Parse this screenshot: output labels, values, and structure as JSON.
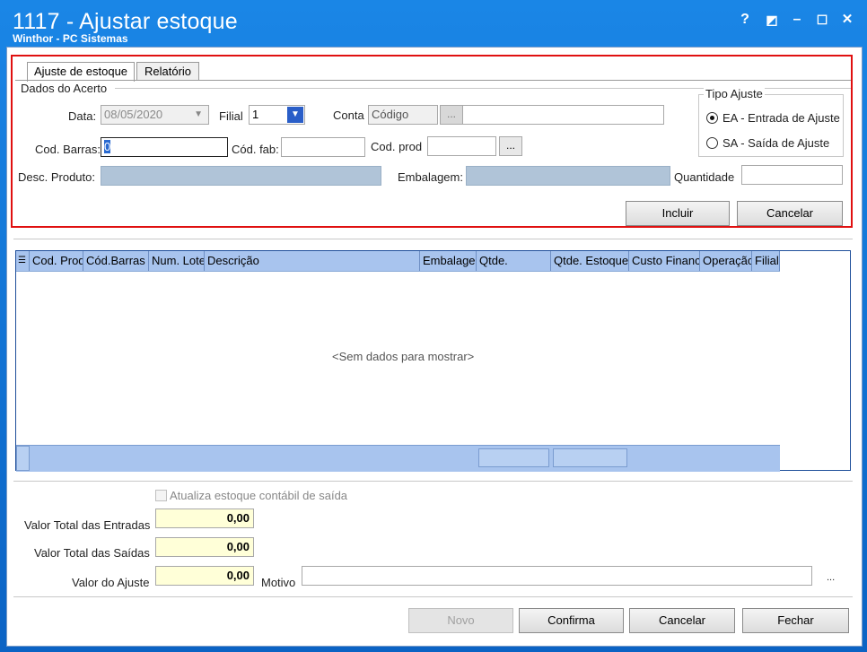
{
  "window": {
    "title": "1117 - Ajustar estoque",
    "subtitle": "Winthor - PC Sistemas",
    "controls": {
      "help": "?",
      "theme": "◩",
      "minimize": "–",
      "maximize": "☐",
      "close": "✕"
    }
  },
  "tabs": [
    {
      "label": "Ajuste de estoque",
      "active": true
    },
    {
      "label": "Relatório",
      "active": false
    }
  ],
  "dados_acerto": {
    "group_label": "Dados do Acerto",
    "data_label": "Data:",
    "data_value": "08/05/2020",
    "filial_label": "Filial",
    "filial_value": "1",
    "conta_label": "Conta",
    "conta_placeholder": "Código",
    "conta_button": "...",
    "cod_barras_label": "Cod. Barras:",
    "cod_barras_value": "0",
    "cod_fab_label": "Cód. fab:",
    "cod_prod_label": "Cod. prod",
    "cod_prod_button": "...",
    "desc_produto_label": "Desc. Produto:",
    "embalagem_label": "Embalagem:",
    "quantidade_label": "Quantidade"
  },
  "tipo_ajuste": {
    "label": "Tipo Ajuste",
    "options": [
      {
        "label": "EA - Entrada de Ajuste",
        "selected": true
      },
      {
        "label": "SA - Saída de Ajuste",
        "selected": false
      }
    ]
  },
  "form_buttons": {
    "incluir": "Incluir",
    "cancelar": "Cancelar"
  },
  "grid": {
    "columns": [
      "Cod. Prod",
      "Cód.Barras",
      "Num. Lote",
      "Descrição",
      "Embalagem",
      "Qtde.",
      "Qtde. Estoque",
      "Custo Financ",
      "Operação",
      "Filial"
    ],
    "empty_text": "<Sem dados para mostrar>"
  },
  "totals": {
    "atualiza_label": "Atualiza estoque contábil de saída",
    "valor_entradas_label": "Valor Total das Entradas",
    "valor_entradas": "0,00",
    "valor_saidas_label": "Valor Total das Saídas",
    "valor_saidas": "0,00",
    "valor_ajuste_label": "Valor do Ajuste",
    "valor_ajuste": "0,00",
    "motivo_label": "Motivo",
    "motivo_button": "..."
  },
  "footer_buttons": {
    "novo": "Novo",
    "confirma": "Confirma",
    "cancelar": "Cancelar",
    "fechar": "Fechar"
  }
}
